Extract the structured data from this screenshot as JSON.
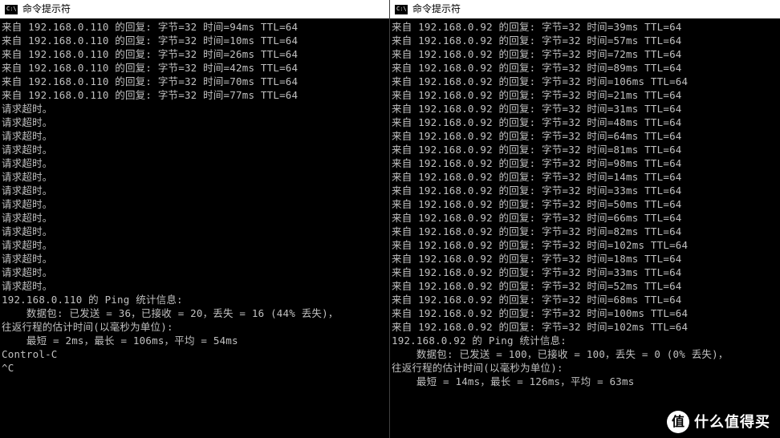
{
  "left": {
    "title": "命令提示符",
    "icon_label": "C:\\",
    "ip": "192.168.0.110",
    "replies": [
      {
        "bytes": 32,
        "time": 94,
        "ttl": 64
      },
      {
        "bytes": 32,
        "time": 10,
        "ttl": 64
      },
      {
        "bytes": 32,
        "time": 26,
        "ttl": 64
      },
      {
        "bytes": 32,
        "time": 42,
        "ttl": 64
      },
      {
        "bytes": 32,
        "time": 70,
        "ttl": 64
      },
      {
        "bytes": 32,
        "time": 77,
        "ttl": 64
      }
    ],
    "timeouts": 14,
    "timeout_text": "请求超时。",
    "stats": {
      "header": "192.168.0.110 的 Ping 统计信息:",
      "packets": "    数据包: 已发送 = 36，已接收 = 20，丢失 = 16 (44% 丢失)，",
      "rtt_header": "往返行程的估计时间(以毫秒为单位):",
      "rtt": "    最短 = 2ms，最长 = 106ms，平均 = 54ms"
    },
    "control_c": "Control-C",
    "caret_c": "^C"
  },
  "right": {
    "title": "命令提示符",
    "icon_label": "C:\\",
    "ip": "192.168.0.92",
    "replies": [
      {
        "bytes": 32,
        "time": 39,
        "ttl": 64
      },
      {
        "bytes": 32,
        "time": 57,
        "ttl": 64
      },
      {
        "bytes": 32,
        "time": 72,
        "ttl": 64
      },
      {
        "bytes": 32,
        "time": 89,
        "ttl": 64
      },
      {
        "bytes": 32,
        "time": 106,
        "ttl": 64
      },
      {
        "bytes": 32,
        "time": 21,
        "ttl": 64
      },
      {
        "bytes": 32,
        "time": 31,
        "ttl": 64
      },
      {
        "bytes": 32,
        "time": 48,
        "ttl": 64
      },
      {
        "bytes": 32,
        "time": 64,
        "ttl": 64
      },
      {
        "bytes": 32,
        "time": 81,
        "ttl": 64
      },
      {
        "bytes": 32,
        "time": 98,
        "ttl": 64
      },
      {
        "bytes": 32,
        "time": 14,
        "ttl": 64
      },
      {
        "bytes": 32,
        "time": 33,
        "ttl": 64
      },
      {
        "bytes": 32,
        "time": 50,
        "ttl": 64
      },
      {
        "bytes": 32,
        "time": 66,
        "ttl": 64
      },
      {
        "bytes": 32,
        "time": 82,
        "ttl": 64
      },
      {
        "bytes": 32,
        "time": 102,
        "ttl": 64
      },
      {
        "bytes": 32,
        "time": 18,
        "ttl": 64
      },
      {
        "bytes": 32,
        "time": 33,
        "ttl": 64
      },
      {
        "bytes": 32,
        "time": 52,
        "ttl": 64
      },
      {
        "bytes": 32,
        "time": 68,
        "ttl": 64
      },
      {
        "bytes": 32,
        "time": 100,
        "ttl": 64
      },
      {
        "bytes": 32,
        "time": 102,
        "ttl": 64
      }
    ],
    "stats": {
      "header": "192.168.0.92 的 Ping 统计信息:",
      "packets": "    数据包: 已发送 = 100，已接收 = 100，丢失 = 0 (0% 丢失)，",
      "rtt_header": "往返行程的估计时间(以毫秒为单位):",
      "rtt": "    最短 = 14ms，最长 = 126ms，平均 = 63ms"
    }
  },
  "reply_prefix": "来自 ",
  "reply_mid": " 的回复: 字节=",
  "reply_time": " 时间=",
  "reply_ttl": "ms TTL=",
  "watermark": {
    "badge": "值",
    "text": "什么值得买"
  }
}
